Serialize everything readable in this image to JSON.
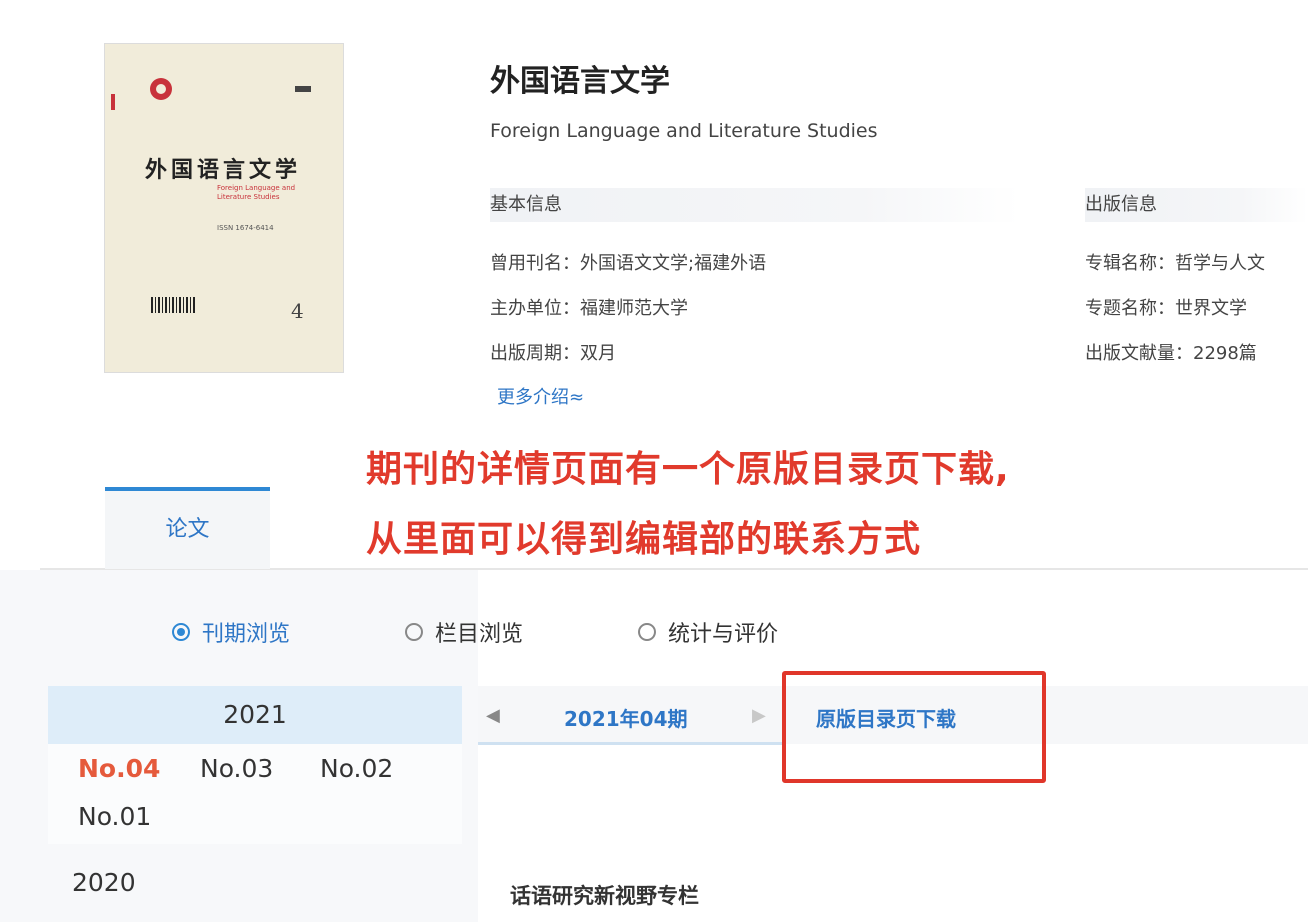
{
  "cover": {
    "title": "外国语言文学",
    "subtitle": "Foreign Language and Literature Studies",
    "meta": "ISSN 1674-6414",
    "number": "4"
  },
  "journal": {
    "title_cn": "外国语言文学",
    "title_en": "Foreign Language and Literature Studies"
  },
  "basic_info": {
    "heading": "基本信息",
    "rows": [
      {
        "label": "曾用刊名：",
        "value": "外国语文文学;福建外语"
      },
      {
        "label": "主办单位：",
        "value": "福建师范大学"
      },
      {
        "label": "出版周期：",
        "value": "双月"
      }
    ],
    "more_label": "更多介绍≈"
  },
  "publish_info": {
    "heading": "出版信息",
    "rows": [
      {
        "label": "专辑名称：",
        "value": "哲学与人文"
      },
      {
        "label": "专题名称：",
        "value": "世界文学"
      },
      {
        "label": "出版文献量：",
        "value": "2298篇"
      }
    ]
  },
  "annotation": {
    "line1": "期刊的详情页面有一个原版目录页下载,",
    "line2": "从里面可以得到编辑部的联系方式",
    "color": "#e13a2c"
  },
  "tabs": [
    {
      "label": "论文",
      "active": true
    }
  ],
  "browse_modes": [
    {
      "label": "刊期浏览",
      "selected": true
    },
    {
      "label": "栏目浏览",
      "selected": false
    },
    {
      "label": "统计与评价",
      "selected": false
    }
  ],
  "years": {
    "current": "2021",
    "issues": [
      "No.04",
      "No.03",
      "No.02",
      "No.01"
    ],
    "active_issue": "No.04",
    "other": "2020"
  },
  "issue_nav": {
    "prev_icon": "◀",
    "current": "2021年04期",
    "next_icon": "▶",
    "toc_download": "原版目录页下载"
  },
  "content": {
    "section_title": "话语研究新视野专栏"
  },
  "colors": {
    "accent": "#2e76c6",
    "highlight": "#e0362a",
    "active_issue": "#e55a3c"
  }
}
